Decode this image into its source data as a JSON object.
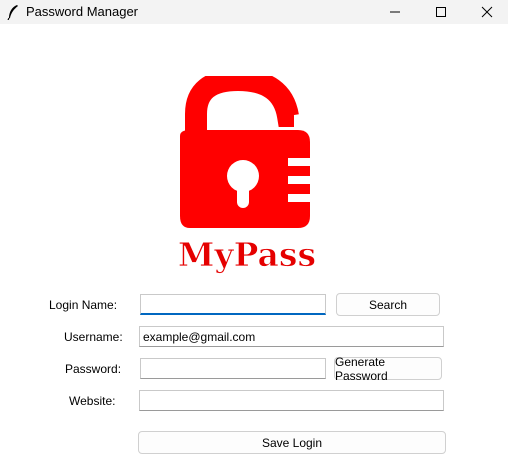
{
  "window": {
    "title": "Password Manager",
    "icon": "feather-icon",
    "controls": [
      "minimize-icon",
      "maximize-icon",
      "close-icon"
    ]
  },
  "logo": {
    "text": "MyPass",
    "icon": "open-padlock-icon",
    "color": "#ff0000"
  },
  "form": {
    "login_name_label": "Login Name:",
    "login_name_value": "",
    "search_label": "Search",
    "username_label": "Username:",
    "username_value": "example@gmail.com",
    "password_label": "Password:",
    "password_value": "",
    "generate_label": "Generate Password",
    "website_label": "Website:",
    "website_value": "",
    "save_label": "Save Login"
  }
}
